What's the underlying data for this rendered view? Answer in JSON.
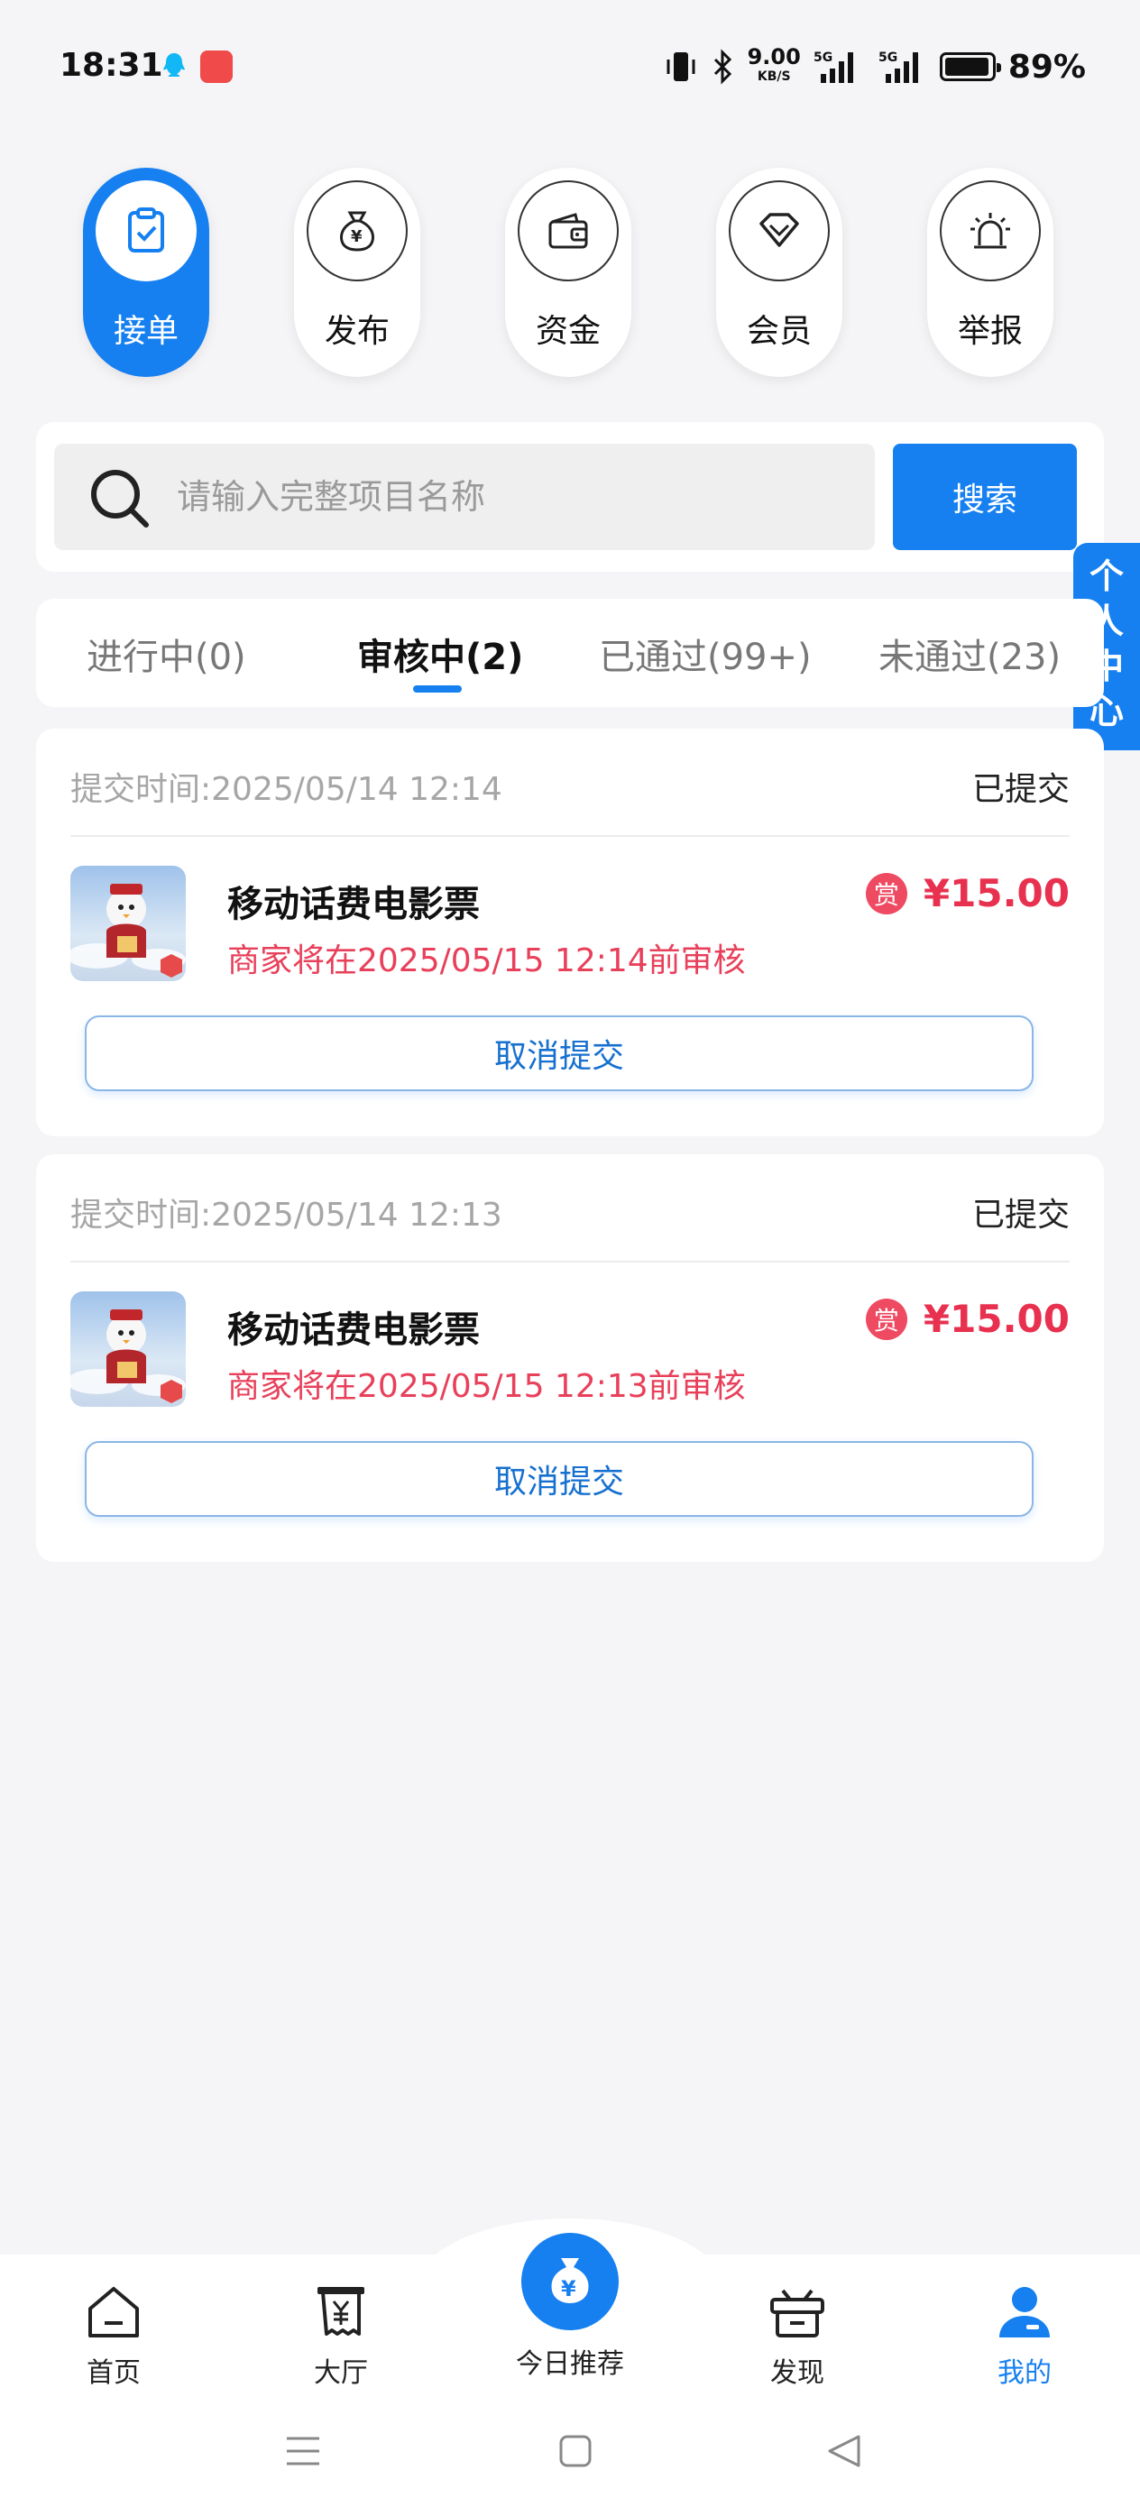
{
  "status_bar": {
    "time": "18:31",
    "speed_value": "9.00",
    "speed_unit": "KB/S",
    "net1": "5G",
    "net2": "5G",
    "battery": "89%"
  },
  "top_nav": [
    {
      "label": "接单",
      "icon": "clipboard-check-icon",
      "active": true
    },
    {
      "label": "发布",
      "icon": "money-bag-icon",
      "active": false
    },
    {
      "label": "资金",
      "icon": "wallet-icon",
      "active": false
    },
    {
      "label": "会员",
      "icon": "diamond-icon",
      "active": false
    },
    {
      "label": "举报",
      "icon": "alarm-icon",
      "active": false
    }
  ],
  "search": {
    "placeholder": "请输入完整项目名称",
    "button_label": "搜索"
  },
  "side_float": {
    "label": "个人中心"
  },
  "tabs": [
    {
      "label": "进行中(0)"
    },
    {
      "label": "审核中(2)"
    },
    {
      "label": "已通过(99+)"
    },
    {
      "label": "未通过(23)"
    }
  ],
  "active_tab": "审核中(2)",
  "orders": [
    {
      "submit_time": "提交时间:2025/05/14 12:14",
      "status": "已提交",
      "product_name": "移动话费电影票",
      "reward_badge": "赏",
      "price": "¥15.00",
      "notice": "商家将在2025/05/15 12:14前审核",
      "cancel_label": "取消提交"
    },
    {
      "submit_time": "提交时间:2025/05/14 12:13",
      "status": "已提交",
      "product_name": "移动话费电影票",
      "reward_badge": "赏",
      "price": "¥15.00",
      "notice": "商家将在2025/05/15 12:13前审核",
      "cancel_label": "取消提交"
    }
  ],
  "bottom_nav": [
    {
      "label": "首页",
      "icon": "home-icon"
    },
    {
      "label": "大厅",
      "icon": "hall-icon"
    },
    {
      "label": "今日推荐",
      "icon": "money-bag-icon"
    },
    {
      "label": "发现",
      "icon": "gift-box-icon"
    },
    {
      "label": "我的",
      "icon": "user-icon",
      "active": true
    }
  ],
  "colors": {
    "primary": "#1680f0",
    "price_red": "#e8304f",
    "notice_red": "#e8405a",
    "background": "#f5f5f7"
  }
}
